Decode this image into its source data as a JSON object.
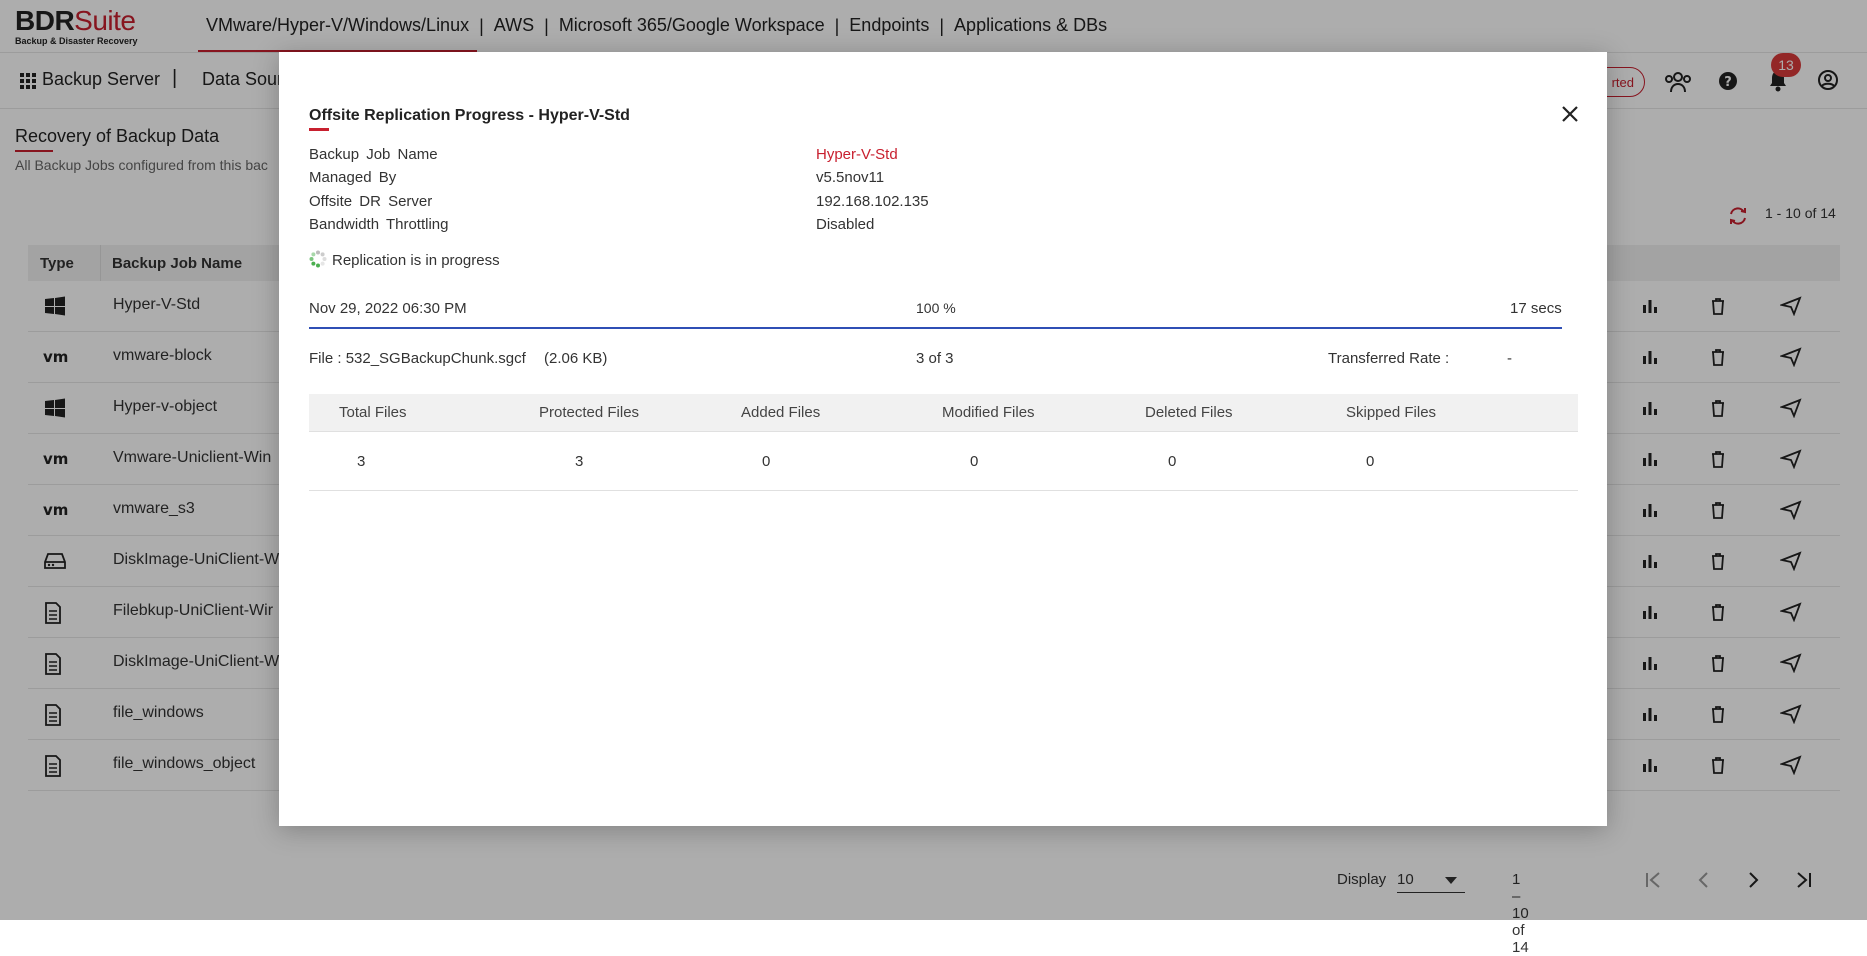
{
  "brand": {
    "name_main": "BDR",
    "name_suite": "Suite",
    "tagline": "Backup & Disaster Recovery"
  },
  "top_nav": [
    "VMware/Hyper-V/Windows/Linux",
    "AWS",
    "Microsoft 365/Google Workspace",
    "Endpoints",
    "Applications & DBs"
  ],
  "top_nav_separator": "|",
  "sub_nav": {
    "backup_server": "Backup Server",
    "separator": "|",
    "data_sources": "Data Sour",
    "status_fragment": "rted"
  },
  "notifications": {
    "count": "13"
  },
  "page": {
    "title": "Recovery of Backup Data",
    "subtitle": "All Backup Jobs configured from this bac",
    "range_top": "1 - 10 of 14"
  },
  "bg_table": {
    "headers": {
      "type": "Type",
      "name": "Backup Job Name"
    },
    "rows": [
      {
        "type_icon": "windows-icon",
        "name": "Hyper-V-Std"
      },
      {
        "type_icon": "vmware-icon",
        "name": "vmware-block"
      },
      {
        "type_icon": "windows-icon",
        "name": "Hyper-v-object"
      },
      {
        "type_icon": "vmware-icon",
        "name": "Vmware-Uniclient-Win"
      },
      {
        "type_icon": "vmware-icon",
        "name": "vmware_s3"
      },
      {
        "type_icon": "disk-icon",
        "name": "DiskImage-UniClient-W"
      },
      {
        "type_icon": "file-icon",
        "name": "Filebkup-UniClient-Wir"
      },
      {
        "type_icon": "file-icon",
        "name": "DiskImage-UniClient-W"
      },
      {
        "type_icon": "file-icon",
        "name": "file_windows"
      },
      {
        "type_icon": "file-icon",
        "name": "file_windows_object"
      }
    ]
  },
  "pager": {
    "display_label": "Display",
    "page_size": "10",
    "range": "1 – 10 of 14"
  },
  "modal": {
    "title": "Offsite Replication Progress - Hyper-V-Std",
    "fields": [
      {
        "label": "Backup Job Name",
        "value": "Hyper-V-Std",
        "highlight": true
      },
      {
        "label": "Managed By",
        "value": "v5.5nov11",
        "highlight": false
      },
      {
        "label": "Offsite DR Server",
        "value": "192.168.102.135",
        "highlight": false
      },
      {
        "label": "Bandwidth Throttling",
        "value": "Disabled",
        "highlight": false
      }
    ],
    "status_text": "Replication is in progress",
    "progress": {
      "date": "Nov 29, 2022 06:30 PM",
      "percent_text": "100 %",
      "fraction": 1.0,
      "elapsed": "17 secs",
      "bar_color": "#2f4fb5"
    },
    "file": {
      "label": "File :",
      "name": "532_SGBackupChunk.sgcf",
      "size": "(2.06 KB)",
      "count": "3 of 3",
      "rate_label": "Transferred Rate :",
      "rate_value": "-"
    },
    "stats_headers": [
      "Total Files",
      "Protected Files",
      "Added Files",
      "Modified Files",
      "Deleted Files",
      "Skipped Files"
    ],
    "stats_values": [
      "3",
      "3",
      "0",
      "0",
      "0",
      "0"
    ]
  },
  "colors": {
    "accent": "#c8202f",
    "progress": "#2f4fb5",
    "badge": "#d93a3a"
  }
}
